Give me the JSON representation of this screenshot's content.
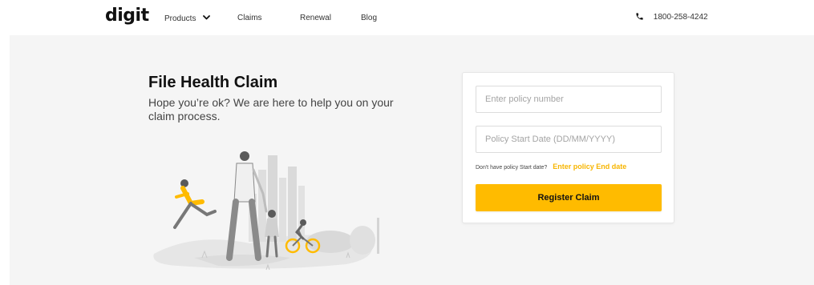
{
  "header": {
    "logo": "digit",
    "nav": {
      "products": "Products",
      "claims": "Claims",
      "renewal": "Renewal",
      "blog": "Blog"
    },
    "phone": "1800-258-4242"
  },
  "hero": {
    "title": "File Health Claim",
    "subtitle": "Hope you’re ok? We are here to help you on your claim process."
  },
  "form": {
    "policy_number_placeholder": "Enter policy number",
    "start_date_placeholder": "Policy Start Date (DD/MM/YYYY)",
    "hint_text": "Don't have policy Start date?",
    "hint_link": "Enter policy End date",
    "submit_label": "Register Claim"
  },
  "colors": {
    "accent": "#ffbb00",
    "link": "#f7b500",
    "background": "#f5f5f5"
  },
  "icons": {
    "products_dropdown": "chevron-down-icon",
    "phone": "phone-icon"
  }
}
